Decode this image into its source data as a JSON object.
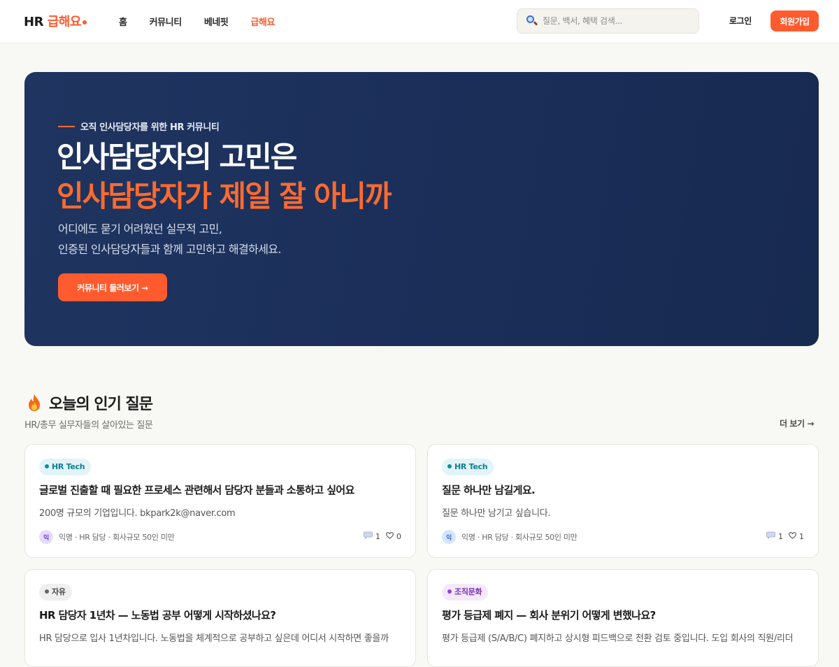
{
  "nav": {
    "logo_hr": "HR",
    "logo_brand": "급해요",
    "menu": [
      {
        "label": "홈",
        "active": false
      },
      {
        "label": "커뮤니티",
        "active": false
      },
      {
        "label": "베네핏",
        "active": false
      },
      {
        "label": "급해요",
        "active": true
      }
    ],
    "search_placeholder": "질문, 백서, 혜택 검색...",
    "login_label": "로그인",
    "signup_label": "회원가입"
  },
  "hero": {
    "kicker": "오직 인사담당자를 위한 HR 커뮤니티",
    "title_line1": "인사담당자의 고민은",
    "title_line2": "인사담당자가 제일 잘 아니까",
    "desc_line1": "어디에도 묻기 어려웠던 실무적 고민,",
    "desc_line2": "인증된 인사담당자들과 함께 고민하고 해결하세요.",
    "cta_label": "커뮤니티 둘러보기 →"
  },
  "popular": {
    "title": "오늘의 인기 질문",
    "subtitle": "HR/총무 실무자들의 살아있는 질문",
    "more_label": "더 보기 →",
    "cards": [
      {
        "tag": "HR Tech",
        "title": "글로벌 진출할 때 필요한 프로세스 관련해서 담당자 분들과 소통하고 싶어요",
        "body": "200명 규모의 기업입니다. bkpark2k@naver.com",
        "avatar": "익",
        "meta": "익명 · HR 담당 · 회사규모 50인 미만",
        "comments": "1",
        "likes": "0"
      },
      {
        "tag": "HR Tech",
        "title": "질문 하나만 남길게요.",
        "body": "질문 하나만 남기고 싶습니다.",
        "avatar": "익",
        "meta": "익명 · HR 담당 · 회사규모 50인 미만",
        "comments": "1",
        "likes": "1"
      },
      {
        "tag": "자유",
        "title": "HR 담당자 1년차 — 노동법 공부 어떻게 시작하셨나요?",
        "body": "HR 담당으로 입사 1년차입니다. 노동법을 체계적으로 공부하고 싶은데 어디서 시작하면 좋을까"
      },
      {
        "tag": "조직문화",
        "title": "평가 등급제 폐지 — 회사 분위기 어떻게 변했나요?",
        "body": "평가 등급제 (S/A/B/C) 폐지하고 상시형 피드백으로 전환 검토 중입니다. 도입 회사의 직원/리더"
      }
    ]
  },
  "colors": {
    "accent": "#ff5b2e",
    "hero_bg": "#1b2f5a",
    "page_bg": "#f8f8f4"
  }
}
